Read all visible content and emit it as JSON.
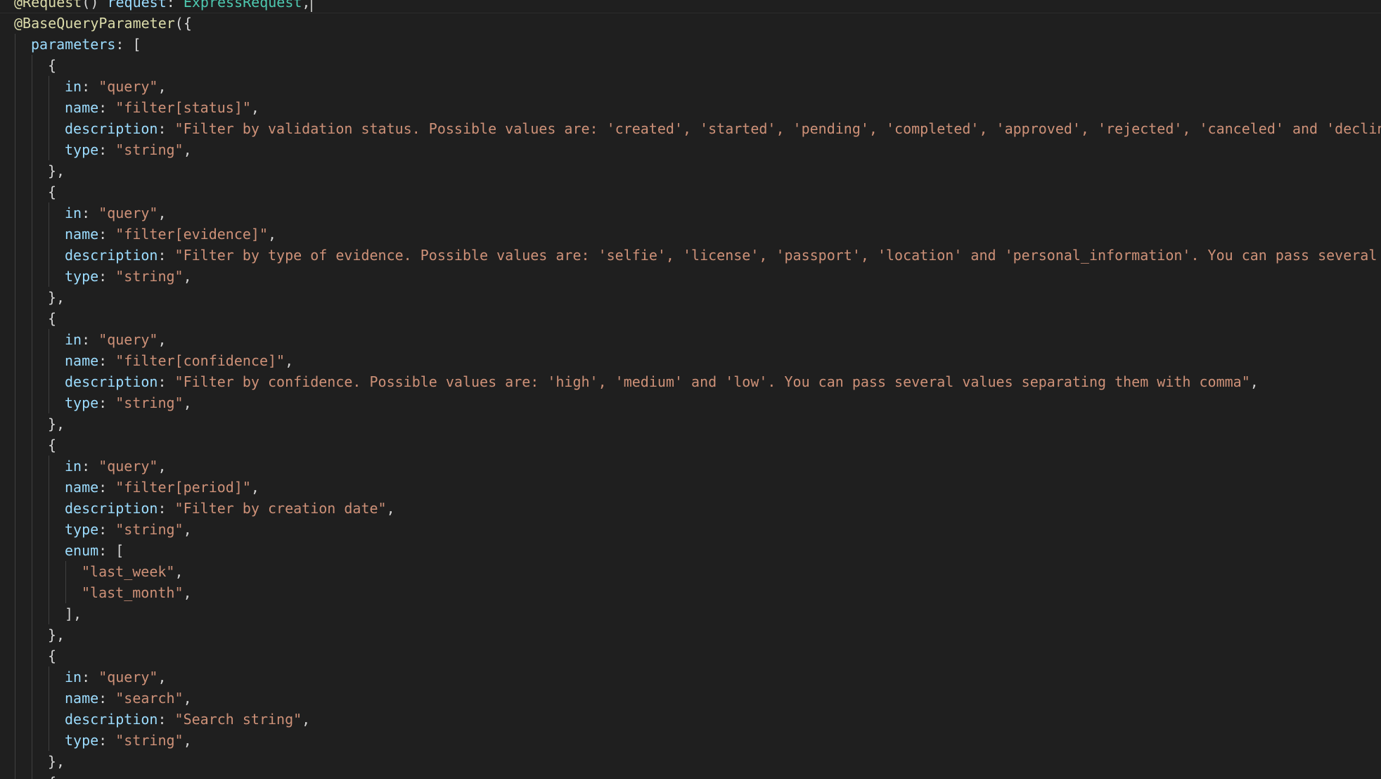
{
  "editor": {
    "colors": {
      "background": "#1f1f1f",
      "decorator": "#dcdcaa",
      "property": "#9cdcfe",
      "type": "#4ec9b0",
      "string": "#ce9178",
      "punctuation": "#d4d4d4"
    },
    "lines": [
      {
        "indent": 0,
        "tokens": [
          {
            "t": "@Request",
            "c": "dec"
          },
          {
            "t": "() ",
            "c": "punc"
          },
          {
            "t": "request",
            "c": "var"
          },
          {
            "t": ": ",
            "c": "punc"
          },
          {
            "t": "ExpressRequest",
            "c": "type"
          },
          {
            "t": ",",
            "c": "punc"
          }
        ],
        "cursor": true
      },
      {
        "indent": 0,
        "tokens": [
          {
            "t": "@BaseQueryParameter",
            "c": "dec"
          },
          {
            "t": "({",
            "c": "punc"
          }
        ]
      },
      {
        "indent": 1,
        "tokens": [
          {
            "t": "parameters",
            "c": "var"
          },
          {
            "t": ": [",
            "c": "punc"
          }
        ]
      },
      {
        "indent": 2,
        "tokens": [
          {
            "t": "{",
            "c": "punc"
          }
        ]
      },
      {
        "indent": 3,
        "tokens": [
          {
            "t": "in",
            "c": "var"
          },
          {
            "t": ": ",
            "c": "punc"
          },
          {
            "t": "\"query\"",
            "c": "str"
          },
          {
            "t": ",",
            "c": "punc"
          }
        ]
      },
      {
        "indent": 3,
        "tokens": [
          {
            "t": "name",
            "c": "var"
          },
          {
            "t": ": ",
            "c": "punc"
          },
          {
            "t": "\"filter[status]\"",
            "c": "str"
          },
          {
            "t": ",",
            "c": "punc"
          }
        ]
      },
      {
        "indent": 3,
        "tokens": [
          {
            "t": "description",
            "c": "var"
          },
          {
            "t": ": ",
            "c": "punc"
          },
          {
            "t": "\"Filter by validation status. Possible values are: 'created', 'started', 'pending', 'completed', 'approved', 'rejected', 'canceled' and 'declin",
            "c": "str"
          }
        ]
      },
      {
        "indent": 3,
        "tokens": [
          {
            "t": "type",
            "c": "var"
          },
          {
            "t": ": ",
            "c": "punc"
          },
          {
            "t": "\"string\"",
            "c": "str"
          },
          {
            "t": ",",
            "c": "punc"
          }
        ]
      },
      {
        "indent": 2,
        "tokens": [
          {
            "t": "},",
            "c": "punc"
          }
        ]
      },
      {
        "indent": 2,
        "tokens": [
          {
            "t": "{",
            "c": "punc"
          }
        ]
      },
      {
        "indent": 3,
        "tokens": [
          {
            "t": "in",
            "c": "var"
          },
          {
            "t": ": ",
            "c": "punc"
          },
          {
            "t": "\"query\"",
            "c": "str"
          },
          {
            "t": ",",
            "c": "punc"
          }
        ]
      },
      {
        "indent": 3,
        "tokens": [
          {
            "t": "name",
            "c": "var"
          },
          {
            "t": ": ",
            "c": "punc"
          },
          {
            "t": "\"filter[evidence]\"",
            "c": "str"
          },
          {
            "t": ",",
            "c": "punc"
          }
        ]
      },
      {
        "indent": 3,
        "tokens": [
          {
            "t": "description",
            "c": "var"
          },
          {
            "t": ": ",
            "c": "punc"
          },
          {
            "t": "\"Filter by type of evidence. Possible values are: 'selfie', 'license', 'passport', 'location' and 'personal_information'. You can pass several",
            "c": "str"
          }
        ]
      },
      {
        "indent": 3,
        "tokens": [
          {
            "t": "type",
            "c": "var"
          },
          {
            "t": ": ",
            "c": "punc"
          },
          {
            "t": "\"string\"",
            "c": "str"
          },
          {
            "t": ",",
            "c": "punc"
          }
        ]
      },
      {
        "indent": 2,
        "tokens": [
          {
            "t": "},",
            "c": "punc"
          }
        ]
      },
      {
        "indent": 2,
        "tokens": [
          {
            "t": "{",
            "c": "punc"
          }
        ]
      },
      {
        "indent": 3,
        "tokens": [
          {
            "t": "in",
            "c": "var"
          },
          {
            "t": ": ",
            "c": "punc"
          },
          {
            "t": "\"query\"",
            "c": "str"
          },
          {
            "t": ",",
            "c": "punc"
          }
        ]
      },
      {
        "indent": 3,
        "tokens": [
          {
            "t": "name",
            "c": "var"
          },
          {
            "t": ": ",
            "c": "punc"
          },
          {
            "t": "\"filter[confidence]\"",
            "c": "str"
          },
          {
            "t": ",",
            "c": "punc"
          }
        ]
      },
      {
        "indent": 3,
        "tokens": [
          {
            "t": "description",
            "c": "var"
          },
          {
            "t": ": ",
            "c": "punc"
          },
          {
            "t": "\"Filter by confidence. Possible values are: 'high', 'medium' and 'low'. You can pass several values separating them with comma\"",
            "c": "str"
          },
          {
            "t": ",",
            "c": "punc"
          }
        ]
      },
      {
        "indent": 3,
        "tokens": [
          {
            "t": "type",
            "c": "var"
          },
          {
            "t": ": ",
            "c": "punc"
          },
          {
            "t": "\"string\"",
            "c": "str"
          },
          {
            "t": ",",
            "c": "punc"
          }
        ]
      },
      {
        "indent": 2,
        "tokens": [
          {
            "t": "},",
            "c": "punc"
          }
        ]
      },
      {
        "indent": 2,
        "tokens": [
          {
            "t": "{",
            "c": "punc"
          }
        ]
      },
      {
        "indent": 3,
        "tokens": [
          {
            "t": "in",
            "c": "var"
          },
          {
            "t": ": ",
            "c": "punc"
          },
          {
            "t": "\"query\"",
            "c": "str"
          },
          {
            "t": ",",
            "c": "punc"
          }
        ]
      },
      {
        "indent": 3,
        "tokens": [
          {
            "t": "name",
            "c": "var"
          },
          {
            "t": ": ",
            "c": "punc"
          },
          {
            "t": "\"filter[period]\"",
            "c": "str"
          },
          {
            "t": ",",
            "c": "punc"
          }
        ]
      },
      {
        "indent": 3,
        "tokens": [
          {
            "t": "description",
            "c": "var"
          },
          {
            "t": ": ",
            "c": "punc"
          },
          {
            "t": "\"Filter by creation date\"",
            "c": "str"
          },
          {
            "t": ",",
            "c": "punc"
          }
        ]
      },
      {
        "indent": 3,
        "tokens": [
          {
            "t": "type",
            "c": "var"
          },
          {
            "t": ": ",
            "c": "punc"
          },
          {
            "t": "\"string\"",
            "c": "str"
          },
          {
            "t": ",",
            "c": "punc"
          }
        ]
      },
      {
        "indent": 3,
        "tokens": [
          {
            "t": "enum",
            "c": "var"
          },
          {
            "t": ": [",
            "c": "punc"
          }
        ]
      },
      {
        "indent": 4,
        "tokens": [
          {
            "t": "\"last_week\"",
            "c": "str"
          },
          {
            "t": ",",
            "c": "punc"
          }
        ]
      },
      {
        "indent": 4,
        "tokens": [
          {
            "t": "\"last_month\"",
            "c": "str"
          },
          {
            "t": ",",
            "c": "punc"
          }
        ]
      },
      {
        "indent": 3,
        "tokens": [
          {
            "t": "],",
            "c": "punc"
          }
        ]
      },
      {
        "indent": 2,
        "tokens": [
          {
            "t": "},",
            "c": "punc"
          }
        ]
      },
      {
        "indent": 2,
        "tokens": [
          {
            "t": "{",
            "c": "punc"
          }
        ]
      },
      {
        "indent": 3,
        "tokens": [
          {
            "t": "in",
            "c": "var"
          },
          {
            "t": ": ",
            "c": "punc"
          },
          {
            "t": "\"query\"",
            "c": "str"
          },
          {
            "t": ",",
            "c": "punc"
          }
        ]
      },
      {
        "indent": 3,
        "tokens": [
          {
            "t": "name",
            "c": "var"
          },
          {
            "t": ": ",
            "c": "punc"
          },
          {
            "t": "\"search\"",
            "c": "str"
          },
          {
            "t": ",",
            "c": "punc"
          }
        ]
      },
      {
        "indent": 3,
        "tokens": [
          {
            "t": "description",
            "c": "var"
          },
          {
            "t": ": ",
            "c": "punc"
          },
          {
            "t": "\"Search string\"",
            "c": "str"
          },
          {
            "t": ",",
            "c": "punc"
          }
        ]
      },
      {
        "indent": 3,
        "tokens": [
          {
            "t": "type",
            "c": "var"
          },
          {
            "t": ": ",
            "c": "punc"
          },
          {
            "t": "\"string\"",
            "c": "str"
          },
          {
            "t": ",",
            "c": "punc"
          }
        ]
      },
      {
        "indent": 2,
        "tokens": [
          {
            "t": "},",
            "c": "punc"
          }
        ]
      },
      {
        "indent": 2,
        "tokens": [
          {
            "t": "{",
            "c": "punc"
          }
        ]
      }
    ]
  }
}
